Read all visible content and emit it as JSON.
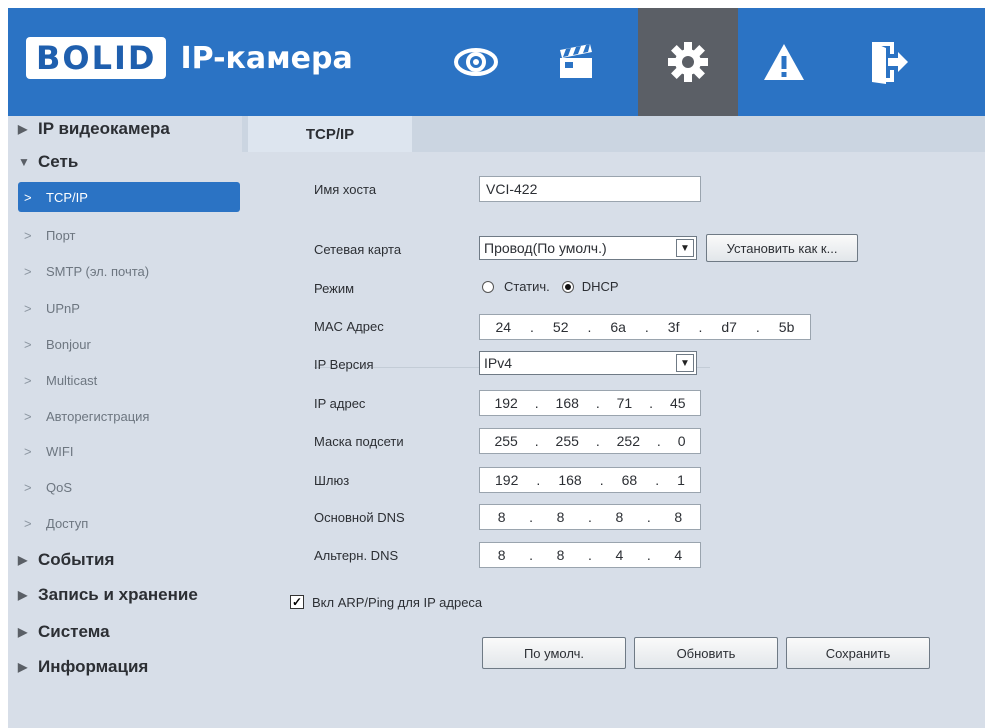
{
  "header": {
    "logo": "BOLID",
    "title": "IP-камера",
    "nav": [
      "live-view-eye-icon",
      "playback-clapper-icon",
      "settings-gear-icon",
      "alarm-warning-icon",
      "logout-icon"
    ],
    "active_nav": "settings-gear-icon",
    "accent_color": "#2b73c4"
  },
  "sidebar": {
    "groups": [
      {
        "label": "IP видеокамера",
        "expanded": false
      },
      {
        "label": "Сеть",
        "expanded": true
      },
      {
        "label": "События",
        "expanded": false
      },
      {
        "label": "Запись и хранение",
        "expanded": false
      },
      {
        "label": "Система",
        "expanded": false
      },
      {
        "label": "Информация",
        "expanded": false
      }
    ],
    "items": [
      "TCP/IP",
      "Порт",
      "SMTP (эл. почта)",
      "UPnP",
      "Bonjour",
      "Multicast",
      "Авторегистрация",
      "WIFI",
      "QoS",
      "Доступ"
    ],
    "active_item": "TCP/IP"
  },
  "tab": "TCP/IP",
  "form": {
    "hostname_label": "Имя хоста",
    "hostname_value": "VCI-422",
    "netcard_label": "Сетевая карта",
    "netcard_value": "Провод(По умолч.)",
    "set_default_button": "Установить как к...",
    "mode_label": "Режим",
    "mode_static": "Статич.",
    "mode_dhcp": "DHCP",
    "mode_selected": "DHCP",
    "mac_label": "MAC Адрес",
    "mac": [
      "24",
      "52",
      "6a",
      "3f",
      "d7",
      "5b"
    ],
    "ipver_label": "IP Версия",
    "ipver_value": "IPv4",
    "ip_label": "IP адрес",
    "ip": [
      "192",
      "168",
      "71",
      "45"
    ],
    "mask_label": "Маска подсети",
    "mask": [
      "255",
      "255",
      "252",
      "0"
    ],
    "gateway_label": "Шлюз",
    "gateway": [
      "192",
      "168",
      "68",
      "1"
    ],
    "dns1_label": "Основной DNS",
    "dns1": [
      "8",
      "8",
      "8",
      "8"
    ],
    "dns2_label": "Альтерн. DNS",
    "dns2": [
      "8",
      "8",
      "4",
      "4"
    ],
    "arp_label": "Вкл ARP/Ping для IP адреса",
    "arp_checked": true
  },
  "buttons": {
    "default": "По умолч.",
    "refresh": "Обновить",
    "save": "Сохранить"
  }
}
